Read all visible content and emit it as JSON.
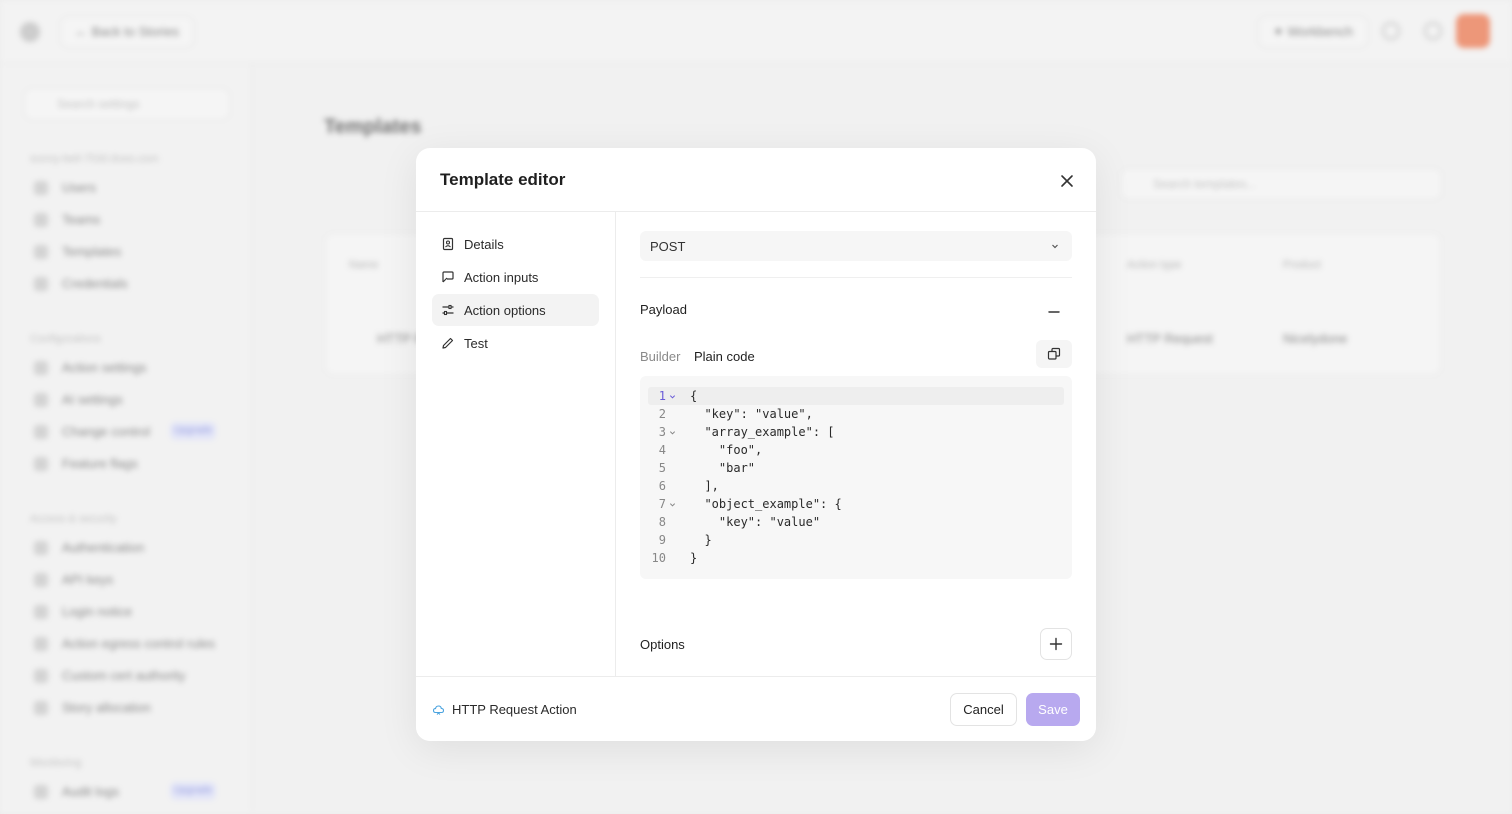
{
  "background": {
    "back_label": "Back to Stories",
    "workbench_label": "Workbench",
    "search_placeholder": "Search settings",
    "tenant": "sunny-bell-7530.tines.com",
    "sections": [
      {
        "heading": "",
        "items": [
          "Users",
          "Teams",
          "Templates",
          "Credentials"
        ]
      },
      {
        "heading": "Configurations",
        "items": [
          "Action settings",
          "AI settings",
          "Change control",
          "Feature flags"
        ]
      },
      {
        "heading": "Access & security",
        "items": [
          "Authentication",
          "API keys",
          "Login notice",
          "Action egress control rules",
          "Custom cert authority",
          "Story allocation"
        ]
      },
      {
        "heading": "Monitoring",
        "items": [
          "Audit logs"
        ]
      }
    ],
    "badge_label": "Upgrade",
    "page_title": "Templates",
    "templates_search_placeholder": "Search templates...",
    "table_headers": [
      "Name",
      "Action type",
      "Product"
    ],
    "table_row": {
      "name": "HTTP R",
      "action_type": "HTTP Request",
      "product": "Nicelydone"
    }
  },
  "modal": {
    "title": "Template editor",
    "nav": [
      {
        "label": "Details",
        "icon": "id-card-icon"
      },
      {
        "label": "Action inputs",
        "icon": "input-icon"
      },
      {
        "label": "Action options",
        "icon": "sliders-icon",
        "active": true
      },
      {
        "label": "Test",
        "icon": "pencil-icon"
      }
    ],
    "method_value": "POST",
    "payload_label": "Payload",
    "tabs": {
      "builder": "Builder",
      "plain": "Plain code",
      "active": "plain"
    },
    "code_lines": [
      {
        "n": "1",
        "text": "{",
        "fold": true
      },
      {
        "n": "2",
        "text": "  \"key\": \"value\",",
        "fold": false
      },
      {
        "n": "3",
        "text": "  \"array_example\": [",
        "fold": true
      },
      {
        "n": "4",
        "text": "    \"foo\",",
        "fold": false
      },
      {
        "n": "5",
        "text": "    \"bar\"",
        "fold": false
      },
      {
        "n": "6",
        "text": "  ],",
        "fold": false
      },
      {
        "n": "7",
        "text": "  \"object_example\": {",
        "fold": true
      },
      {
        "n": "8",
        "text": "    \"key\": \"value\"",
        "fold": false
      },
      {
        "n": "9",
        "text": "  }",
        "fold": false
      },
      {
        "n": "10",
        "text": "}",
        "fold": false
      }
    ],
    "options_label": "Options",
    "footer": {
      "action_type": "HTTP Request Action",
      "cancel_label": "Cancel",
      "save_label": "Save"
    }
  },
  "colors": {
    "accent": "#6a5cd8",
    "save_disabled": "#b8a9ef",
    "code_bg": "#f7f7f7"
  }
}
